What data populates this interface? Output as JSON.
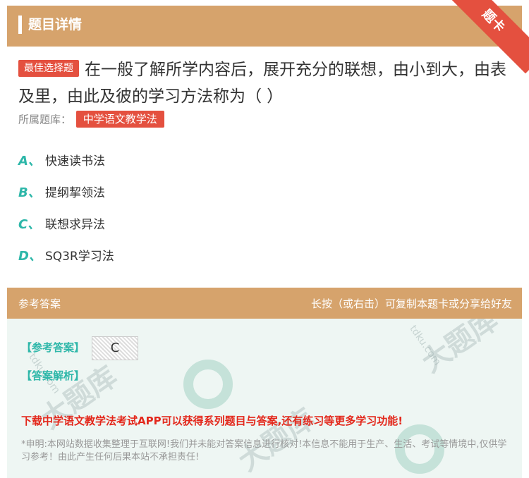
{
  "header": {
    "title": "题目详情",
    "ribbon": "题卡"
  },
  "question": {
    "type_tag": "最佳选择题",
    "text": "在一般了解所学内容后，展开充分的联想，由小到大，由表及里，由此及彼的学习方法称为（ ）",
    "bank_label": "所属题库：",
    "bank_name": "中学语文教学法"
  },
  "options": [
    {
      "letter": "A、",
      "text": "快速读书法"
    },
    {
      "letter": "B、",
      "text": "提纲挈领法"
    },
    {
      "letter": "C、",
      "text": "联想求异法"
    },
    {
      "letter": "D、",
      "text": "SQ3R学习法"
    }
  ],
  "answer_bar": {
    "left": "参考答案",
    "right": "长按（或右击）可复制本题卡或分享给好友"
  },
  "answer_panel": {
    "answer_label": "【参考答案】",
    "answer_value": "C",
    "analysis_label": "【答案解析】",
    "promo": "下载中学语文教学法考试APP可以获得系列题目与答案,还有练习等更多学习功能!",
    "disclaimer": "*申明:本网站数据收集整理于互联网!我们并未能对答案信息进行核对!本信息不能用于生产、生活、考试等情境中,仅供学习参考！由此产生任何后果本站不承担责任!"
  },
  "watermark": {
    "text": "大题库",
    "url": "tdku.com"
  },
  "colors": {
    "header": "#d6a36c",
    "accent_red": "#e4503f",
    "option_letter": "#2eb7a9",
    "promo": "#e3271b"
  }
}
